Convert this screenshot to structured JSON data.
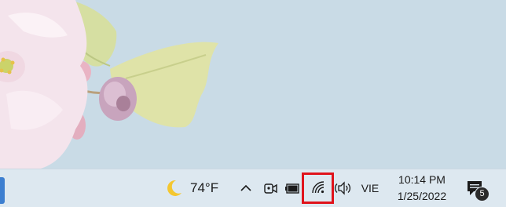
{
  "taskbar": {
    "weather": {
      "icon": "crescent-moon-icon",
      "temperature": "74°F"
    },
    "tray": {
      "show_hidden_icon": "chevron-up-icon",
      "meet_now_icon": "camera-icon",
      "battery_icon": "battery-icon",
      "network_icon": "wifi-icon",
      "volume_icon": "speaker-icon",
      "highlight_color": "#e0131b"
    },
    "language": "VIE",
    "clock": {
      "time": "10:14 PM",
      "date": "1/25/2022"
    },
    "notifications": {
      "icon": "notification-center-icon",
      "count": "5"
    }
  },
  "colors": {
    "sky": "#c9dbe6",
    "taskbar": "#dde8f0",
    "accent": "#3d7fd0"
  }
}
